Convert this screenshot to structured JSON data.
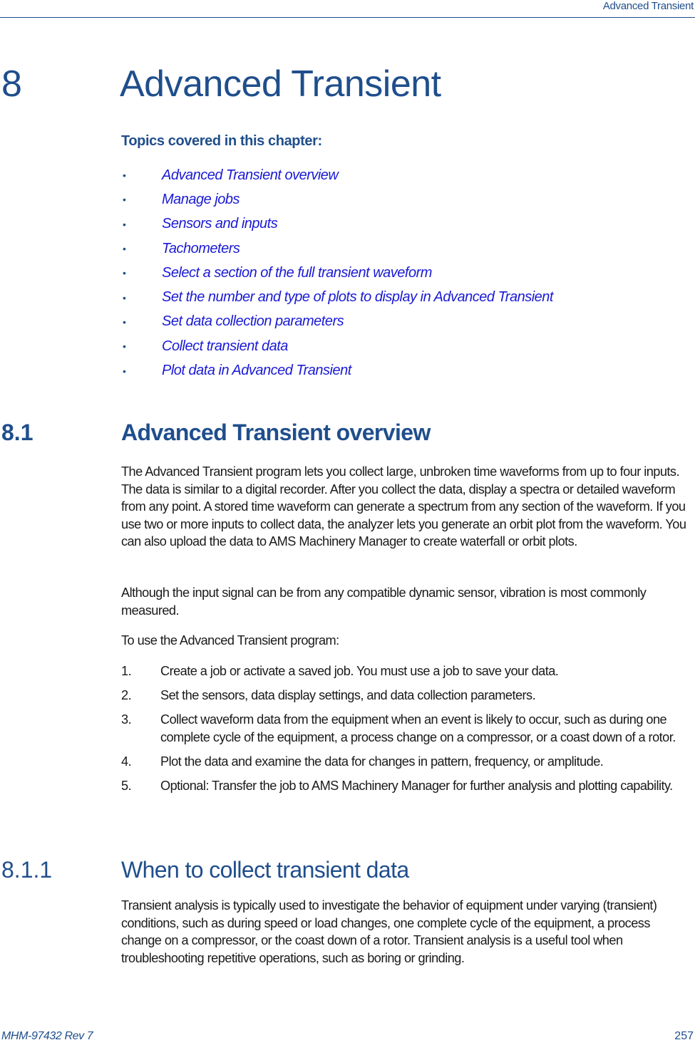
{
  "header": {
    "running_title": "Advanced Transient"
  },
  "chapter": {
    "number": "8",
    "title": "Advanced Transient"
  },
  "topics": {
    "heading": "Topics covered in this chapter:",
    "bullet": "•",
    "items": [
      "Advanced Transient overview",
      "Manage jobs",
      "Sensors and inputs",
      "Tachometers",
      "Select a section of the full transient waveform",
      "Set the number and type of plots to display in Advanced Transient",
      "Set data collection parameters",
      "Collect transient data",
      "Plot data in Advanced Transient"
    ]
  },
  "section_8_1": {
    "number": "8.1",
    "title": "Advanced Transient overview",
    "paragraphs": [
      "The Advanced Transient program lets you collect large, unbroken time waveforms from up to four inputs. The data is similar to a digital recorder. After you collect the data, display a spectra or detailed waveform from any point. A stored time waveform can generate a spectrum from any section of the waveform. If you use two or more inputs to collect data, the analyzer lets you generate an orbit plot from the waveform. You can also upload the data to AMS Machinery Manager to create waterfall or orbit plots.",
      "Although the input signal can be from any compatible dynamic sensor, vibration is most commonly measured.",
      "To use the Advanced Transient program:"
    ],
    "steps": [
      {
        "num": "1.",
        "text": "Create a job or activate a saved job. You must use a job to save your data."
      },
      {
        "num": "2.",
        "text": "Set the sensors, data display settings, and data collection parameters."
      },
      {
        "num": "3.",
        "text": "Collect waveform data from the equipment when an event is likely to occur, such as during one complete cycle of the equipment, a process change on a compressor, or a coast down of a rotor."
      },
      {
        "num": "4.",
        "text": "Plot the data and examine the data for changes in pattern, frequency, or amplitude."
      },
      {
        "num": "5.",
        "text": "Optional: Transfer the job to AMS Machinery Manager for further analysis and plotting capability."
      }
    ]
  },
  "section_8_1_1": {
    "number": "8.1.1",
    "title": "When to collect transient data",
    "paragraph": "Transient analysis is typically used to investigate the behavior of equipment under varying (transient) conditions, such as during speed or load changes, one complete cycle of the equipment, a process change on a compressor, or the coast down of a rotor. Transient analysis is a useful tool when troubleshooting repetitive operations, such as boring or grinding."
  },
  "footer": {
    "document_id": "MHM-97432 Rev 7",
    "page_number": "257"
  }
}
